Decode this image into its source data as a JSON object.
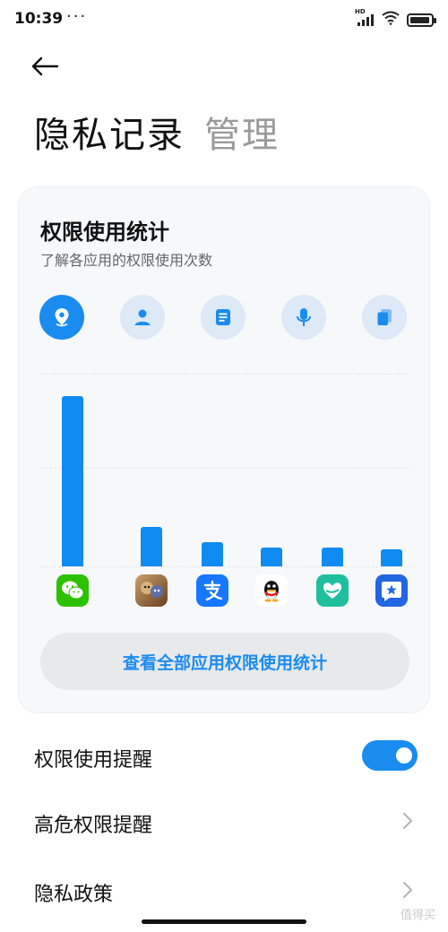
{
  "status": {
    "time": "10:39",
    "dots": "···",
    "network": "HD"
  },
  "header": {
    "title": "隐私记录",
    "tab": "管理"
  },
  "card": {
    "title": "权限使用统计",
    "subtitle": "了解各应用的权限使用次数",
    "permission_tabs": [
      {
        "icon": "location-icon",
        "active": true
      },
      {
        "icon": "contacts-icon",
        "active": false
      },
      {
        "icon": "sms-icon",
        "active": false
      },
      {
        "icon": "microphone-icon",
        "active": false
      },
      {
        "icon": "files-icon",
        "active": false
      }
    ],
    "button_label": "查看全部应用权限使用统计"
  },
  "chart_data": {
    "type": "bar",
    "categories": [
      "WeChat",
      "Game",
      "Alipay",
      "QQ",
      "Heart app",
      "Star app"
    ],
    "values": [
      100,
      23,
      14,
      11,
      11,
      10
    ],
    "ylim": [
      0,
      100
    ],
    "grid": true
  },
  "apps": [
    {
      "icon": "wechat-icon",
      "color": "#2dc100"
    },
    {
      "icon": "game-app-icon",
      "color": "#7a4b2b"
    },
    {
      "icon": "alipay-icon",
      "color": "#1677ff"
    },
    {
      "icon": "qq-icon",
      "color": "#111111"
    },
    {
      "icon": "heart-app-icon",
      "color": "#1fbf9e"
    },
    {
      "icon": "star-app-icon",
      "color": "#2266e0"
    }
  ],
  "settings": {
    "usage_reminder": {
      "label": "权限使用提醒",
      "enabled": true
    },
    "high_risk_reminder": {
      "label": "高危权限提醒"
    },
    "privacy_policy": {
      "label": "隐私政策"
    }
  },
  "watermark": "值得买",
  "colors": {
    "accent": "#1a8cf0",
    "bar": "#0f8bf2"
  }
}
